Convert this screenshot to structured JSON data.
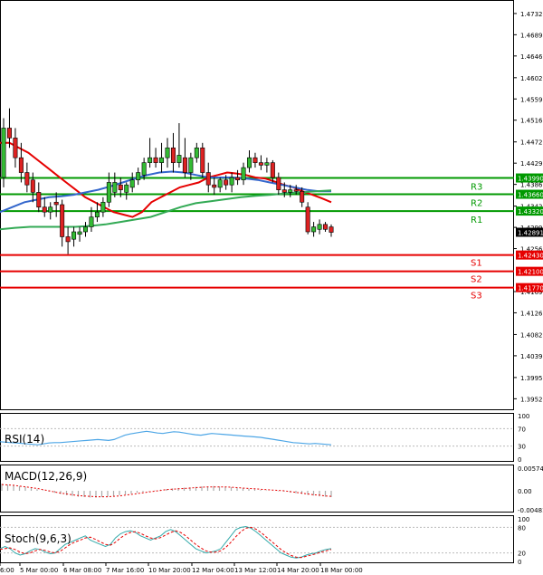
{
  "chart_data": [
    {
      "panel": "price",
      "type": "candlestick",
      "y_axis_ticks": [
        "1.47320",
        "1.46890",
        "1.46460",
        "1.46020",
        "1.45590",
        "1.45160",
        "1.44720",
        "1.44290",
        "1.43860",
        "1.43420",
        "1.42990",
        "1.42560",
        "1.41690",
        "1.41260",
        "1.40820",
        "1.40390",
        "1.39950",
        "1.39520"
      ],
      "x_axis_ticks": [
        "6:00",
        "5 Mar 00:00",
        "6 Mar 08:00",
        "7 Mar 16:00",
        "10 Mar 20:00",
        "12 Mar 04:00",
        "13 Mar 12:00",
        "14 Mar 20:00",
        "18 Mar 00:00"
      ],
      "ylim": [
        1.3938,
        1.4752
      ],
      "current_price": "1.42891",
      "current_price_value": 1.42891,
      "levels": [
        {
          "name": "R3",
          "label": "1.43990",
          "value": 1.4399,
          "color": "#009900"
        },
        {
          "name": "R2",
          "label": "1.43660",
          "value": 1.4366,
          "color": "#009900"
        },
        {
          "name": "R1",
          "label": "1.43320",
          "value": 1.4332,
          "color": "#009900"
        },
        {
          "name": "S1",
          "label": "1.42430",
          "value": 1.4243,
          "color": "#e60000"
        },
        {
          "name": "S2",
          "label": "1.42100",
          "value": 1.421,
          "color": "#e60000"
        },
        {
          "name": "S3",
          "label": "1.41770",
          "value": 1.4177,
          "color": "#e60000"
        }
      ],
      "candles": [
        {
          "o": 1.44,
          "h": 1.452,
          "l": 1.438,
          "c": 1.45
        },
        {
          "o": 1.45,
          "h": 1.454,
          "l": 1.446,
          "c": 1.448
        },
        {
          "o": 1.448,
          "h": 1.45,
          "l": 1.442,
          "c": 1.444
        },
        {
          "o": 1.444,
          "h": 1.447,
          "l": 1.439,
          "c": 1.441
        },
        {
          "o": 1.441,
          "h": 1.443,
          "l": 1.437,
          "c": 1.4385
        },
        {
          "o": 1.4395,
          "h": 1.441,
          "l": 1.435,
          "c": 1.437
        },
        {
          "o": 1.437,
          "h": 1.439,
          "l": 1.433,
          "c": 1.434
        },
        {
          "o": 1.434,
          "h": 1.436,
          "l": 1.432,
          "c": 1.433
        },
        {
          "o": 1.433,
          "h": 1.435,
          "l": 1.4315,
          "c": 1.434
        },
        {
          "o": 1.435,
          "h": 1.437,
          "l": 1.432,
          "c": 1.4345
        },
        {
          "o": 1.4345,
          "h": 1.4355,
          "l": 1.426,
          "c": 1.428
        },
        {
          "o": 1.428,
          "h": 1.43,
          "l": 1.4245,
          "c": 1.427
        },
        {
          "o": 1.4275,
          "h": 1.43,
          "l": 1.426,
          "c": 1.429
        },
        {
          "o": 1.4285,
          "h": 1.43,
          "l": 1.427,
          "c": 1.429
        },
        {
          "o": 1.429,
          "h": 1.431,
          "l": 1.428,
          "c": 1.43
        },
        {
          "o": 1.43,
          "h": 1.434,
          "l": 1.429,
          "c": 1.432
        },
        {
          "o": 1.432,
          "h": 1.435,
          "l": 1.431,
          "c": 1.433
        },
        {
          "o": 1.433,
          "h": 1.436,
          "l": 1.432,
          "c": 1.435
        },
        {
          "o": 1.435,
          "h": 1.441,
          "l": 1.434,
          "c": 1.439
        },
        {
          "o": 1.437,
          "h": 1.441,
          "l": 1.436,
          "c": 1.439
        },
        {
          "o": 1.4385,
          "h": 1.44,
          "l": 1.436,
          "c": 1.4375
        },
        {
          "o": 1.437,
          "h": 1.439,
          "l": 1.4355,
          "c": 1.4385
        },
        {
          "o": 1.438,
          "h": 1.441,
          "l": 1.437,
          "c": 1.4395
        },
        {
          "o": 1.4395,
          "h": 1.442,
          "l": 1.4385,
          "c": 1.441
        },
        {
          "o": 1.4405,
          "h": 1.444,
          "l": 1.4395,
          "c": 1.443
        },
        {
          "o": 1.443,
          "h": 1.448,
          "l": 1.442,
          "c": 1.444
        },
        {
          "o": 1.444,
          "h": 1.446,
          "l": 1.442,
          "c": 1.443
        },
        {
          "o": 1.443,
          "h": 1.447,
          "l": 1.441,
          "c": 1.444
        },
        {
          "o": 1.444,
          "h": 1.448,
          "l": 1.442,
          "c": 1.446
        },
        {
          "o": 1.446,
          "h": 1.449,
          "l": 1.441,
          "c": 1.443
        },
        {
          "o": 1.443,
          "h": 1.451,
          "l": 1.442,
          "c": 1.4445
        },
        {
          "o": 1.444,
          "h": 1.448,
          "l": 1.44,
          "c": 1.441
        },
        {
          "o": 1.441,
          "h": 1.445,
          "l": 1.4395,
          "c": 1.444
        },
        {
          "o": 1.444,
          "h": 1.447,
          "l": 1.443,
          "c": 1.446
        },
        {
          "o": 1.446,
          "h": 1.447,
          "l": 1.44,
          "c": 1.441
        },
        {
          "o": 1.441,
          "h": 1.443,
          "l": 1.437,
          "c": 1.4385
        },
        {
          "o": 1.4385,
          "h": 1.44,
          "l": 1.4365,
          "c": 1.438
        },
        {
          "o": 1.438,
          "h": 1.44,
          "l": 1.437,
          "c": 1.4395
        },
        {
          "o": 1.4395,
          "h": 1.4405,
          "l": 1.4375,
          "c": 1.4385
        },
        {
          "o": 1.4385,
          "h": 1.441,
          "l": 1.437,
          "c": 1.44
        },
        {
          "o": 1.44,
          "h": 1.4415,
          "l": 1.4385,
          "c": 1.4395
        },
        {
          "o": 1.4395,
          "h": 1.443,
          "l": 1.4385,
          "c": 1.442
        },
        {
          "o": 1.442,
          "h": 1.4455,
          "l": 1.441,
          "c": 1.444
        },
        {
          "o": 1.444,
          "h": 1.445,
          "l": 1.442,
          "c": 1.443
        },
        {
          "o": 1.443,
          "h": 1.4445,
          "l": 1.4415,
          "c": 1.4425
        },
        {
          "o": 1.4425,
          "h": 1.444,
          "l": 1.441,
          "c": 1.443
        },
        {
          "o": 1.443,
          "h": 1.4435,
          "l": 1.439,
          "c": 1.44
        },
        {
          "o": 1.44,
          "h": 1.441,
          "l": 1.4365,
          "c": 1.4375
        },
        {
          "o": 1.4375,
          "h": 1.439,
          "l": 1.436,
          "c": 1.437
        },
        {
          "o": 1.437,
          "h": 1.4385,
          "l": 1.436,
          "c": 1.4375
        },
        {
          "o": 1.4375,
          "h": 1.4385,
          "l": 1.4365,
          "c": 1.4372
        },
        {
          "o": 1.4372,
          "h": 1.438,
          "l": 1.434,
          "c": 1.435
        },
        {
          "o": 1.434,
          "h": 1.435,
          "l": 1.4285,
          "c": 1.429
        },
        {
          "o": 1.429,
          "h": 1.431,
          "l": 1.428,
          "c": 1.43
        },
        {
          "o": 1.4295,
          "h": 1.4315,
          "l": 1.4285,
          "c": 1.4305
        },
        {
          "o": 1.4305,
          "h": 1.431,
          "l": 1.429,
          "c": 1.4295
        },
        {
          "o": 1.43,
          "h": 1.4305,
          "l": 1.428,
          "c": 1.4289
        }
      ],
      "moving_averages": [
        {
          "color": "#e60000",
          "values": [
            1.447,
            1.447,
            1.446,
            1.445,
            1.4435,
            1.442,
            1.4405,
            1.439,
            1.4375,
            1.436,
            1.435,
            1.434,
            1.433,
            1.4325,
            1.432,
            1.433,
            1.435,
            1.436,
            1.437,
            1.438,
            1.4385,
            1.439,
            1.44,
            1.4405,
            1.441,
            1.4408,
            1.4405,
            1.44,
            1.4398,
            1.4392,
            1.4385,
            1.438,
            1.4372,
            1.4365,
            1.4358,
            1.435
          ]
        },
        {
          "color": "#3366cc",
          "values": [
            1.433,
            1.434,
            1.435,
            1.4355,
            1.436,
            1.4362,
            1.4365,
            1.437,
            1.4375,
            1.4382,
            1.439,
            1.4398,
            1.4405,
            1.441,
            1.4412,
            1.441,
            1.4405,
            1.44,
            1.44,
            1.44,
            1.4398,
            1.4395,
            1.439,
            1.4385,
            1.438,
            1.4375,
            1.4372,
            1.4372
          ]
        },
        {
          "color": "#33aa55",
          "values": [
            1.4295,
            1.4298,
            1.43,
            1.43,
            1.43,
            1.43,
            1.4302,
            1.4305,
            1.431,
            1.4315,
            1.432,
            1.433,
            1.434,
            1.4348,
            1.4352,
            1.4356,
            1.436,
            1.4363,
            1.4365,
            1.4368,
            1.437,
            1.4372,
            1.4374
          ]
        }
      ]
    },
    {
      "panel": "rsi",
      "type": "line",
      "title": "RSI(14)",
      "y_axis_ticks": [
        "100",
        "70",
        "30",
        "0"
      ],
      "ylim": [
        0,
        100
      ],
      "values": [
        40,
        39,
        38,
        37,
        36,
        35,
        34,
        33,
        35,
        37,
        38,
        38,
        39,
        40,
        41,
        42,
        43,
        44,
        45,
        44,
        43,
        45,
        50,
        55,
        58,
        60,
        62,
        64,
        62,
        60,
        59,
        61,
        63,
        62,
        60,
        58,
        56,
        55,
        57,
        59,
        58,
        57,
        56,
        55,
        54,
        53,
        52,
        51,
        50,
        48,
        46,
        44,
        42,
        40,
        38,
        37,
        36,
        35,
        36,
        35,
        34,
        33
      ],
      "color": "#4da6e6"
    },
    {
      "panel": "macd",
      "type": "bar",
      "title": "MACD(12,26,9)",
      "y_axis_ticks": [
        "0.00574",
        "0.00",
        "-0.00481"
      ],
      "ylim": [
        -0.00481,
        0.00574
      ],
      "histogram": [
        0.0018,
        0.0016,
        0.0014,
        0.0012,
        0.001,
        0.0007,
        0.0004,
        0.0001,
        -0.0002,
        -0.0005,
        -0.0008,
        -0.0011,
        -0.0013,
        -0.0015,
        -0.0016,
        -0.0017,
        -0.0017,
        -0.0016,
        -0.0015,
        -0.0013,
        -0.0011,
        -0.0009,
        -0.0007,
        -0.0005,
        -0.0003,
        -0.0001,
        0.0001,
        0.0003,
        0.0004,
        0.0006,
        0.0007,
        0.0008,
        0.0009,
        0.001,
        0.0011,
        0.0011,
        0.0012,
        0.0011,
        0.001,
        0.0009,
        0.0008,
        0.0007,
        0.0005,
        0.0004,
        0.0002,
        0.0001,
        0.0,
        -0.0001,
        -0.0002,
        -0.0004,
        -0.0006,
        -0.0008,
        -0.001,
        -0.0012,
        -0.0014,
        -0.0015,
        -0.0016
      ],
      "signal": [
        0.0016,
        0.0015,
        0.0014,
        0.0012,
        0.001,
        0.0008,
        0.0006,
        0.0003,
        0.0,
        -0.0003,
        -0.0006,
        -0.0008,
        -0.001,
        -0.0012,
        -0.0013,
        -0.0014,
        -0.0015,
        -0.0015,
        -0.0015,
        -0.0014,
        -0.0013,
        -0.0011,
        -0.0009,
        -0.0007,
        -0.0005,
        -0.0003,
        -0.0001,
        0.0001,
        0.0003,
        0.0004,
        0.0005,
        0.0006,
        0.0007,
        0.0008,
        0.0009,
        0.001,
        0.001,
        0.001,
        0.001,
        0.0009,
        0.0008,
        0.0007,
        0.0006,
        0.0005,
        0.0004,
        0.0003,
        0.0002,
        0.0001,
        0.0,
        -0.0002,
        -0.0004,
        -0.0006,
        -0.0008,
        -0.001,
        -0.0011,
        -0.0013,
        -0.0014
      ],
      "signal_color": "#e60000"
    },
    {
      "panel": "stochastic",
      "type": "line",
      "title": "Stoch(9,6,3)",
      "y_axis_ticks": [
        "100",
        "80",
        "20",
        "0"
      ],
      "ylim": [
        0,
        100
      ],
      "series": [
        {
          "values": [
            30,
            35,
            30,
            20,
            15,
            18,
            25,
            30,
            28,
            22,
            18,
            20,
            30,
            40,
            45,
            50,
            55,
            60,
            50,
            45,
            40,
            35,
            40,
            55,
            65,
            70,
            72,
            68,
            60,
            55,
            50,
            55,
            60,
            70,
            75,
            70,
            60,
            50,
            40,
            30,
            25,
            20,
            22,
            25,
            30,
            45,
            60,
            75,
            80,
            82,
            78,
            70,
            60,
            50,
            40,
            30,
            20,
            15,
            10,
            8,
            10,
            15,
            18,
            20,
            25,
            28,
            30
          ],
          "color": "#33aaaa"
        },
        {
          "values": [
            28,
            30,
            32,
            28,
            22,
            18,
            20,
            25,
            28,
            26,
            22,
            20,
            24,
            32,
            40,
            46,
            50,
            55,
            57,
            52,
            46,
            40,
            38,
            45,
            55,
            63,
            68,
            70,
            66,
            60,
            55,
            53,
            56,
            62,
            68,
            72,
            68,
            60,
            50,
            40,
            32,
            25,
            22,
            22,
            25,
            33,
            45,
            58,
            70,
            78,
            80,
            76,
            68,
            58,
            48,
            38,
            28,
            20,
            14,
            10,
            9,
            12,
            15,
            18,
            22,
            25,
            28
          ],
          "color": "#e60000"
        }
      ]
    }
  ]
}
